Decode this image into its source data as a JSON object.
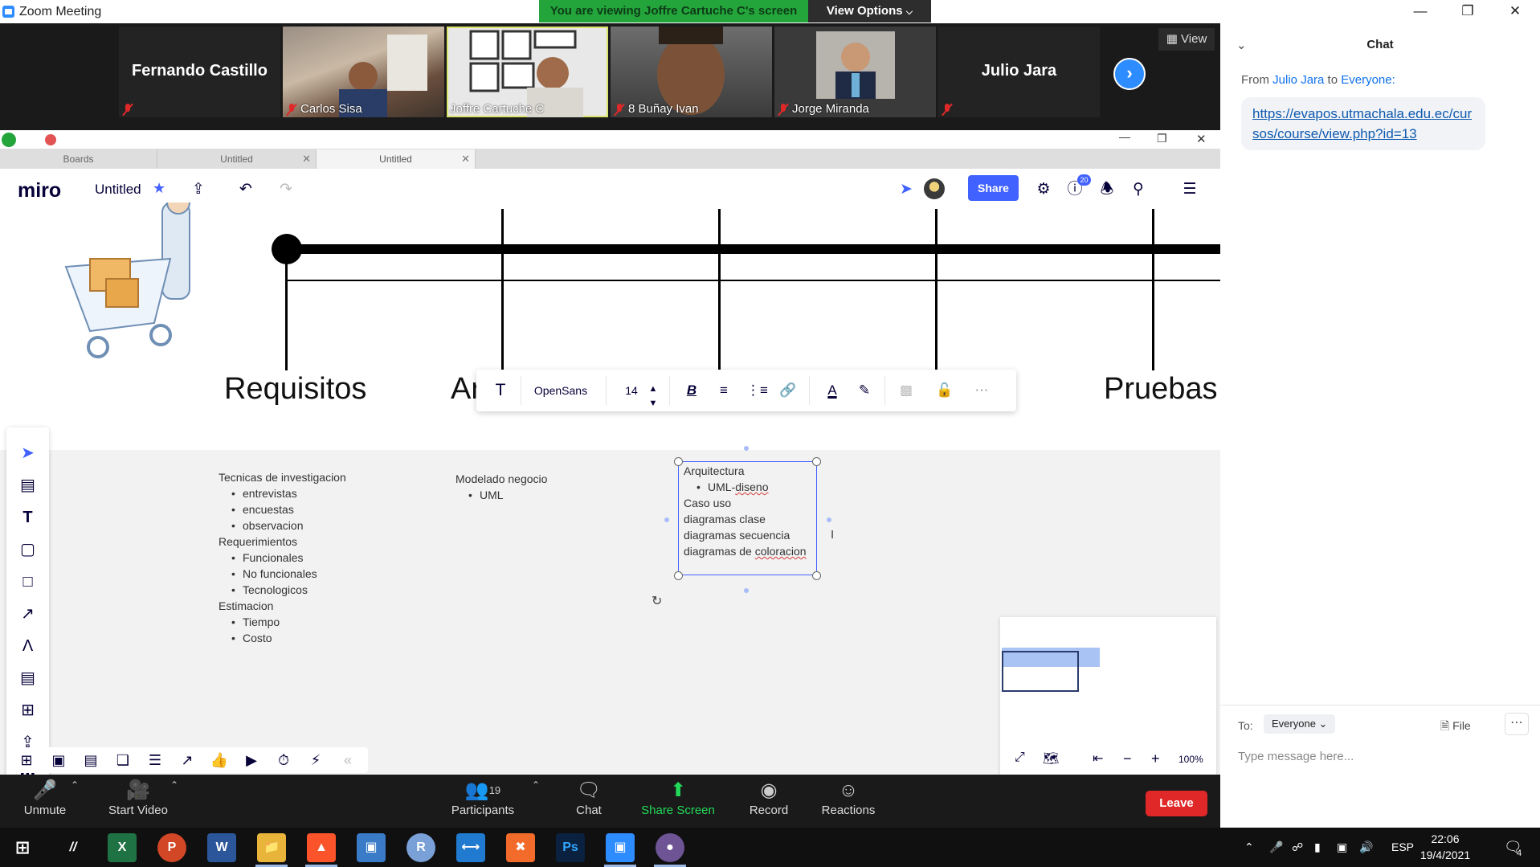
{
  "window": {
    "title": "Zoom Meeting",
    "viewing_banner": "You are viewing Joffre Cartuche C's screen",
    "view_options": "View Options"
  },
  "participants_strip": {
    "tiles": [
      {
        "name": "Fernando Castillo",
        "type": "name-only"
      },
      {
        "name": "Carlos Sisa",
        "type": "video"
      },
      {
        "name": "Joffre Cartuche C",
        "type": "video"
      },
      {
        "name": "8 Buñay Ivan",
        "type": "video"
      },
      {
        "name": "Jorge Miranda",
        "type": "video"
      },
      {
        "name": "Julio Jara",
        "type": "name-only"
      }
    ],
    "view_label": "View"
  },
  "browser": {
    "tabs": [
      {
        "label": "Boards"
      },
      {
        "label": "Untitled"
      },
      {
        "label": "Untitled"
      }
    ]
  },
  "miro": {
    "logo": "miro",
    "board_name": "Untitled",
    "share_label": "Share",
    "notification_count": "20",
    "phases": [
      "Requisitos",
      "Ar",
      "Pruebas"
    ],
    "text_toolbar": {
      "font": "OpenSans",
      "size": "14"
    },
    "notes_col1": {
      "lines": [
        {
          "text": "Tecnicas de investigacion",
          "sub": false
        },
        {
          "text": "entrevistas",
          "sub": true
        },
        {
          "text": "encuestas",
          "sub": true
        },
        {
          "text": "observacion",
          "sub": true
        },
        {
          "text": "Requerimientos",
          "sub": false
        },
        {
          "text": "Funcionales",
          "sub": true
        },
        {
          "text": "No funcionales",
          "sub": true
        },
        {
          "text": "Tecnologicos",
          "sub": true
        },
        {
          "text": "Estimacion",
          "sub": false
        },
        {
          "text": "Tiempo",
          "sub": true
        },
        {
          "text": "Costo",
          "sub": true
        }
      ]
    },
    "notes_col2": {
      "line1": "Modelado negocio",
      "line2": "UML"
    },
    "notes_col3": {
      "line1": "Arquitectura",
      "line2_prefix": "UML-",
      "line2_spell": "diseno",
      "line3": "Caso uso",
      "line4": "diagramas clase",
      "line5": "diagramas secuencia",
      "line6_prefix": "diagramas de ",
      "line6_spell": "coloracion"
    },
    "zoom_level": "100%"
  },
  "chat": {
    "title": "Chat",
    "from_label": "From",
    "from_name": "Julio Jara",
    "to_word": "to",
    "to_name": "Everyone:",
    "message": "https://evapos.utmachala.edu.ec/cursos/course/view.php?id=13",
    "to_label": "To:",
    "recipient": "Everyone",
    "file_label": "File",
    "input_placeholder": "Type message here..."
  },
  "zoom_controls": {
    "unmute": "Unmute",
    "start_video": "Start Video",
    "participants": "Participants",
    "participants_count": "19",
    "chat": "Chat",
    "share_screen": "Share Screen",
    "record": "Record",
    "reactions": "Reactions",
    "leave": "Leave"
  },
  "taskbar": {
    "language": "ESP",
    "time": "22:06",
    "date": "19/4/2021",
    "notifications": "4"
  },
  "colors": {
    "zoom_blue": "#2d8cff",
    "miro_blue": "#4262ff",
    "leave_red": "#e02828",
    "banner_green": "#23a53c"
  }
}
